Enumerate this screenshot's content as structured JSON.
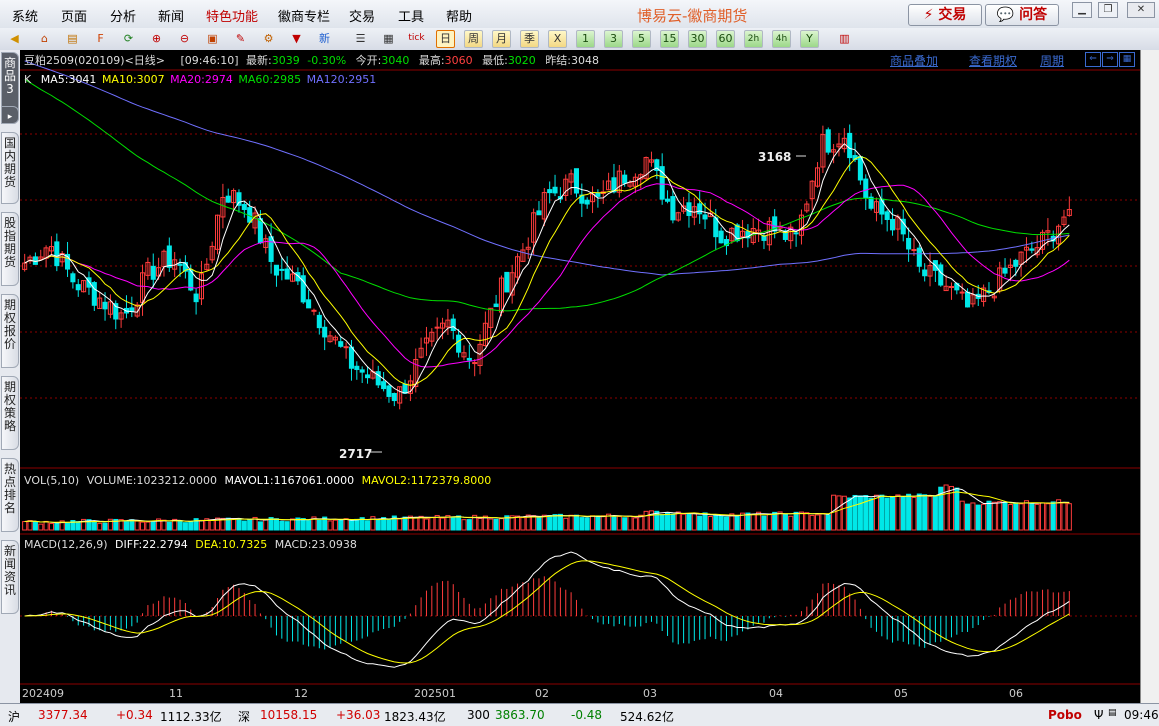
{
  "menu": [
    "系统",
    "页面",
    "分析",
    "新闻",
    "特色功能",
    "徽商专栏",
    "交易",
    "工具",
    "帮助"
  ],
  "menu_hot_index": 4,
  "app_title": "博易云-徽商期货",
  "buttons": {
    "trade": "⚡ 交易",
    "qa": "💬 问答"
  },
  "toolbar_periods": [
    "日",
    "周",
    "月",
    "季",
    "X",
    "1",
    "3",
    "5",
    "15",
    "30",
    "60",
    "2h",
    "4h",
    "Y"
  ],
  "toolbar_selected_period": "日",
  "sidebar_tabs": [
    "商品3",
    "国内期货",
    "股指期货",
    "期权报价",
    "期权策略",
    "热点排名",
    "新闻资讯"
  ],
  "header": {
    "symbol": "豆粕2509",
    "code": "(020109)",
    "period": "<日线>",
    "time": "[09:46:10]",
    "latest_label": "最新:",
    "latest": "3039",
    "change": "-0.30%",
    "open_label": "今开:",
    "open": "3040",
    "high_label": "最高:",
    "high": "3060",
    "low_label": "最低:",
    "low": "3020",
    "prev_label": "昨结:",
    "prev": "3048"
  },
  "links": [
    "商品叠加",
    "查看期权",
    "周期"
  ],
  "ma_legend": {
    "k": "K",
    "ma5": "MA5:3041",
    "ma10": "MA10:3007",
    "ma20": "MA20:2974",
    "ma60": "MA60:2985",
    "ma120": "MA120:2951"
  },
  "vol_legend": {
    "label": "VOL(5,10)",
    "volume": "VOLUME:1023212.0000",
    "mavol1": "MAVOL1:1167061.0000",
    "mavol2": "MAVOL2:1172379.8000"
  },
  "macd_legend": {
    "label": "MACD(12,26,9)",
    "diff": "DIFF:22.2794",
    "dea": "DEA:10.7325",
    "macd": "MACD:23.0938"
  },
  "annotations": {
    "high": "3168",
    "low": "2717"
  },
  "x_axis_labels": [
    "202409",
    "11",
    "12",
    "202501",
    "02",
    "03",
    "04",
    "05",
    "06"
  ],
  "status": {
    "sh_label": "沪",
    "sh_index": "3377.34",
    "sh_change": "+0.34",
    "sh_amount": "1112.33亿",
    "sz_label": "深",
    "sz_index": "10158.15",
    "sz_change": "+36.03",
    "sz_amount": "1823.43亿",
    "c300_label": "300",
    "c300_index": "3863.70",
    "c300_change": "-0.48",
    "c300_amount": "524.62亿",
    "brand": "Pobo",
    "clock": "09:46"
  },
  "colors": {
    "up_candle": "#ff3c3c",
    "down_candle": "#00e8e8",
    "ma5": "#ffffff",
    "ma10": "#ffff00",
    "ma20": "#ff00ff",
    "ma60": "#00e000",
    "ma120": "#7070ff",
    "grid": "#8b0000"
  },
  "chart_data": {
    "type": "candlestick",
    "x": [
      "202409",
      "11",
      "12",
      "202501",
      "02",
      "03",
      "04",
      "05",
      "06"
    ],
    "price_range": [
      2717,
      3168
    ],
    "series": [
      {
        "name": "MA5",
        "last": 3041
      },
      {
        "name": "MA10",
        "last": 3007
      },
      {
        "name": "MA20",
        "last": 2974
      },
      {
        "name": "MA60",
        "last": 2985
      },
      {
        "name": "MA120",
        "last": 2951
      }
    ],
    "close_anchors": [
      2955,
      2985,
      2925,
      2900,
      2870,
      2940,
      2965,
      2900,
      3070,
      3040,
      2950,
      2920,
      2860,
      2800,
      2770,
      2745,
      2810,
      2860,
      2800,
      2900,
      2975,
      3060,
      3080,
      3050,
      3090,
      3120,
      3040,
      3050,
      3000,
      3010,
      3010,
      2990,
      3140,
      3160,
      3040,
      3020,
      2940,
      2920,
      2880,
      2920,
      2960,
      2990,
      3039
    ],
    "volume_last": 1023212,
    "macd": {
      "diff": 22.2794,
      "dea": 10.7325,
      "macd": 23.0938
    }
  }
}
